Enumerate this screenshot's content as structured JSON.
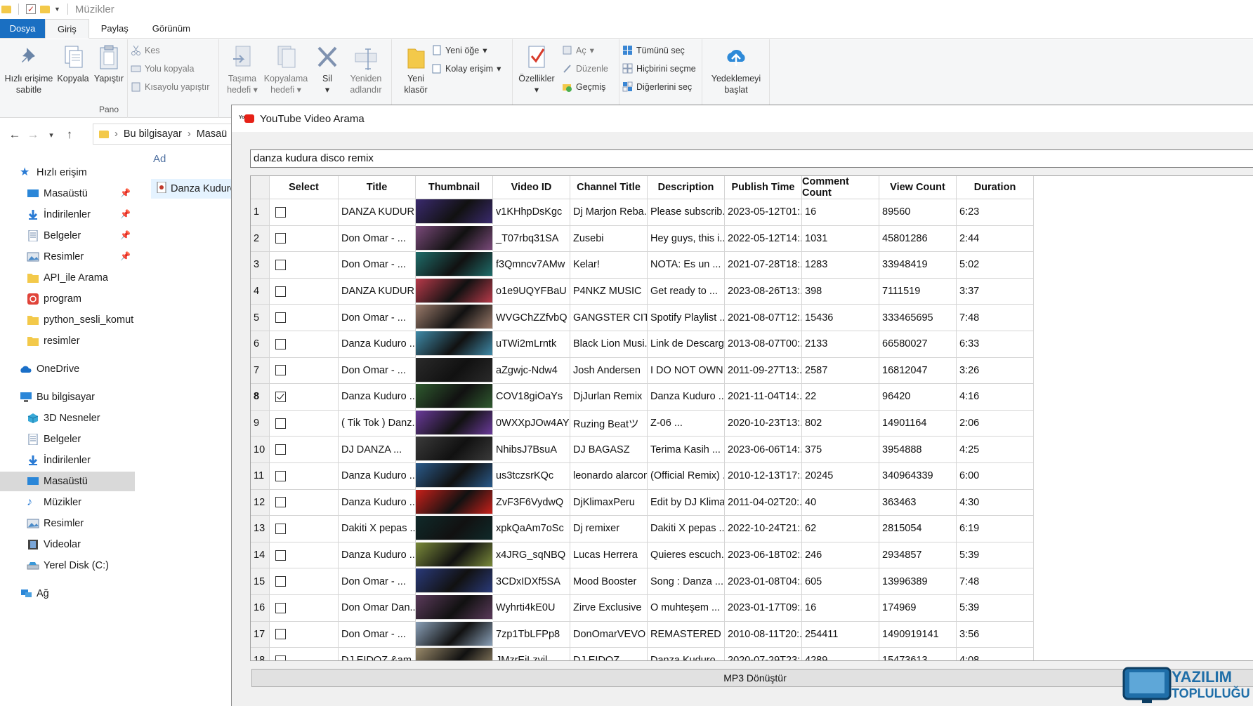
{
  "window": {
    "title": "Müzikler"
  },
  "ribbon_tabs": [
    "Dosya",
    "Giriş",
    "Paylaş",
    "Görünüm"
  ],
  "ribbon": {
    "pano": {
      "name": "Pano",
      "pin": "Hızlı erişime sabitle",
      "copy": "Kopyala",
      "paste": "Yapıştır",
      "cut": "Kes",
      "copy_path": "Yolu kopyala",
      "paste_shortcut": "Kısayolu yapıştır"
    },
    "duzenle": {
      "move_to": "Taşıma hedefi",
      "copy_to": "Kopyalama hedefi",
      "delete": "Sil",
      "rename": "Yeniden adlandır"
    },
    "yeni": {
      "new_folder": "Yeni klasör",
      "new_item": "Yeni öğe",
      "easy_access": "Kolay erişim"
    },
    "ac": {
      "properties": "Özellikler",
      "open": "Aç",
      "edit": "Düzenle",
      "history": "Geçmiş"
    },
    "sec": {
      "select_all": "Tümünü seç",
      "select_none": "Hiçbirini seçme",
      "invert": "Diğerlerini seç"
    },
    "upload": "Yedeklemeyi başlat"
  },
  "address": {
    "path1": "Bu bilgisayar",
    "path2": "Masaü"
  },
  "nav_pane": {
    "quick_access": "Hızlı erişim",
    "quick_items": [
      "Masaüstü",
      "İndirilenler",
      "Belgeler",
      "Resimler",
      "API_ile Arama",
      "program",
      "python_sesli_komut",
      "resimler"
    ],
    "onedrive": "OneDrive",
    "this_pc": "Bu bilgisayar",
    "pc_items": [
      "3D Nesneler",
      "Belgeler",
      "İndirilenler",
      "Masaüstü",
      "Müzikler",
      "Resimler",
      "Videolar",
      "Yerel Disk (C:)"
    ],
    "network": "Ağ"
  },
  "file_list": {
    "column": "Ad",
    "item": "Danza Kuduro"
  },
  "app": {
    "title": "YouTube Video Arama",
    "logo_text": "You",
    "search_value": "danza kudura disco remix",
    "button": "MP3 Dönüştür",
    "columns": [
      "Select",
      "Title",
      "Thumbnail",
      "Video ID",
      "Channel Title",
      "Description",
      "Publish Time",
      "Comment Count",
      "View Count",
      "Duration"
    ],
    "current_row": 8,
    "rows": [
      {
        "n": "1",
        "sel": false,
        "title": "DANZA KUDUR...",
        "vid": "v1KHhpDsKgc",
        "ch": "Dj Marjon Reba...",
        "desc": "Please subscrib...",
        "pub": "2023-05-12T01:...",
        "cc": "16",
        "vc": "89560",
        "dur": "6:23",
        "thumb": "#3a2a6e"
      },
      {
        "n": "2",
        "sel": false,
        "title": "Don Omar - ...",
        "vid": "_T07rbq31SA",
        "ch": "Zusebi",
        "desc": "Hey guys, this i...",
        "pub": "2022-05-12T14:...",
        "cc": "1031",
        "vc": "45801286",
        "dur": "2:44",
        "thumb": "#7a4a7a"
      },
      {
        "n": "3",
        "sel": false,
        "title": "Don Omar - ...",
        "vid": "f3Qmncv7AMw",
        "ch": "Kelar!",
        "desc": "NOTA: Es un ...",
        "pub": "2021-07-28T18:...",
        "cc": "1283",
        "vc": "33948419",
        "dur": "5:02",
        "thumb": "#1f6d6a"
      },
      {
        "n": "4",
        "sel": false,
        "title": "DANZA KUDUR...",
        "vid": "o1e9UQYFBaU",
        "ch": "P4NKZ MUSIC",
        "desc": "Get ready to ...",
        "pub": "2023-08-26T13:...",
        "cc": "398",
        "vc": "7111519",
        "dur": "3:37",
        "thumb": "#b83a4a"
      },
      {
        "n": "5",
        "sel": false,
        "title": "Don Omar - ...",
        "vid": "WVGChZZfvbQ",
        "ch": "GANGSTER CITY",
        "desc": "Spotify Playlist ...",
        "pub": "2021-08-07T12:...",
        "cc": "15436",
        "vc": "333465695",
        "dur": "7:48",
        "thumb": "#9a7a6a"
      },
      {
        "n": "6",
        "sel": false,
        "title": "Danza Kuduro ...",
        "vid": "uTWi2mLrntk",
        "ch": "Black Lion Musi...",
        "desc": "Link de Descarg...",
        "pub": "2013-08-07T00:...",
        "cc": "2133",
        "vc": "66580027",
        "dur": "6:33",
        "thumb": "#3f8aa8"
      },
      {
        "n": "7",
        "sel": false,
        "title": "Don Omar - ...",
        "vid": "aZgwjc-Ndw4",
        "ch": "Josh Andersen",
        "desc": "I DO NOT OWN...",
        "pub": "2011-09-27T13:...",
        "cc": "2587",
        "vc": "16812047",
        "dur": "3:26",
        "thumb": "#2a2a2a"
      },
      {
        "n": "8",
        "sel": true,
        "title": "Danza Kuduro ...",
        "vid": "COV18giOaYs",
        "ch": "DjJurlan Remix",
        "desc": "Danza Kuduro ...",
        "pub": "2021-11-04T14:...",
        "cc": "22",
        "vc": "96420",
        "dur": "4:16",
        "thumb": "#2f5a2f"
      },
      {
        "n": "9",
        "sel": false,
        "title": "( Tik Tok ) Danz...",
        "vid": "0WXXpJOw4AY",
        "ch": "Ruzing Beatツ",
        "desc": "Z-06 ...",
        "pub": "2020-10-23T13:...",
        "cc": "802",
        "vc": "14901164",
        "dur": "2:06",
        "thumb": "#6a3a9a"
      },
      {
        "n": "10",
        "sel": false,
        "title": "DJ DANZA ...",
        "vid": "NhibsJ7BsuA",
        "ch": "DJ BAGASZ",
        "desc": "Terima Kasih ...",
        "pub": "2023-06-06T14:...",
        "cc": "375",
        "vc": "3954888",
        "dur": "4:25",
        "thumb": "#3a3a3a"
      },
      {
        "n": "11",
        "sel": false,
        "title": "Danza Kuduro ...",
        "vid": "us3tczsrKQc",
        "ch": "leonardo alarcon",
        "desc": "(Official Remix) ...",
        "pub": "2010-12-13T17:...",
        "cc": "20245",
        "vc": "340964339",
        "dur": "6:00",
        "thumb": "#2a5a8a"
      },
      {
        "n": "12",
        "sel": false,
        "title": "Danza Kuduro ...",
        "vid": "ZvF3F6VydwQ",
        "ch": "DjKlimaxPeru",
        "desc": "Edit by DJ Klimax...",
        "pub": "2011-04-02T20:...",
        "cc": "40",
        "vc": "363463",
        "dur": "4:30",
        "thumb": "#c8201a"
      },
      {
        "n": "13",
        "sel": false,
        "title": "Dakiti X pepas ...",
        "vid": "xpkQaAm7oSc",
        "ch": "Dj remixer",
        "desc": "Dakiti X pepas ...",
        "pub": "2022-10-24T21:...",
        "cc": "62",
        "vc": "2815054",
        "dur": "6:19",
        "thumb": "#102a2a"
      },
      {
        "n": "14",
        "sel": false,
        "title": "Danza Kuduro ...",
        "vid": "x4JRG_sqNBQ",
        "ch": "Lucas Herrera",
        "desc": "Quieres escuch...",
        "pub": "2023-06-18T02:...",
        "cc": "246",
        "vc": "2934857",
        "dur": "5:39",
        "thumb": "#7a8a3a"
      },
      {
        "n": "15",
        "sel": false,
        "title": "Don Omar - ...",
        "vid": "3CDxIDXf5SA",
        "ch": "Mood Booster",
        "desc": "Song : Danza ...",
        "pub": "2023-01-08T04:...",
        "cc": "605",
        "vc": "13996389",
        "dur": "7:48",
        "thumb": "#2a3a7a"
      },
      {
        "n": "16",
        "sel": false,
        "title": "Don Omar Dan...",
        "vid": "Wyhrti4kE0U",
        "ch": "Zirve Exclusive",
        "desc": "O muhteşem ...",
        "pub": "2023-01-17T09:...",
        "cc": "16",
        "vc": "174969",
        "dur": "5:39",
        "thumb": "#5a3a5a"
      },
      {
        "n": "17",
        "sel": false,
        "title": "Don Omar - ...",
        "vid": "7zp1TbLFPp8",
        "ch": "DonOmarVEVO",
        "desc": "REMASTERED I...",
        "pub": "2010-08-11T20:...",
        "cc": "254411",
        "vc": "1490919141",
        "dur": "3:56",
        "thumb": "#8aa0b8"
      },
      {
        "n": "18",
        "sel": false,
        "title": "DJ EIDOZ &am...",
        "vid": "JMzrEiLzvil",
        "ch": "DJ EIDOZ",
        "desc": "Danza Kuduro ...",
        "pub": "2020-07-29T23:...",
        "cc": "4289",
        "vc": "15473613",
        "dur": "4:08",
        "thumb": "#9a8a6a"
      }
    ]
  },
  "watermark": {
    "line1": "YAZILIM",
    "line2": "TOPLULUĞU"
  }
}
